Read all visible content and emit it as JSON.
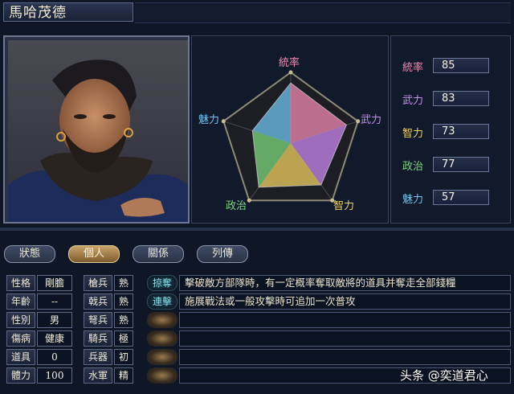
{
  "general": {
    "name": "馬哈茂德"
  },
  "radar": {
    "labels": {
      "top": "統率",
      "right": "武力",
      "bottom_right": "智力",
      "bottom_left": "政治",
      "left": "魅力"
    },
    "max": 100
  },
  "stats": [
    {
      "label": "統率",
      "value": "85",
      "num": 85,
      "color": "#f08ab0"
    },
    {
      "label": "武力",
      "value": "83",
      "num": 83,
      "color": "#c98af0"
    },
    {
      "label": "智力",
      "value": "73",
      "num": 73,
      "color": "#f0d060"
    },
    {
      "label": "政治",
      "value": "77",
      "num": 77,
      "color": "#7ed87e"
    },
    {
      "label": "魅力",
      "value": "57",
      "num": 57,
      "color": "#6fc4f0"
    }
  ],
  "tabs": [
    {
      "label": "狀態",
      "active": false
    },
    {
      "label": "個人",
      "active": true
    },
    {
      "label": "關係",
      "active": false
    },
    {
      "label": "列傳",
      "active": false
    }
  ],
  "attributes": [
    {
      "label": "性格",
      "value": "剛膽"
    },
    {
      "label": "年齡",
      "value": "--"
    },
    {
      "label": "性別",
      "value": "男"
    },
    {
      "label": "傷病",
      "value": "健康"
    },
    {
      "label": "道具",
      "value": "0"
    },
    {
      "label": "體力",
      "value": "100"
    }
  ],
  "aptitudes": [
    {
      "label": "槍兵",
      "grade": "熟"
    },
    {
      "label": "戟兵",
      "grade": "熟"
    },
    {
      "label": "弩兵",
      "grade": "熟"
    },
    {
      "label": "騎兵",
      "grade": "極"
    },
    {
      "label": "兵器",
      "grade": "初"
    },
    {
      "label": "水軍",
      "grade": "精"
    }
  ],
  "skills": [
    {
      "name": "掠奪",
      "desc": "擊破敵方部隊時，有一定概率奪取敵將的道具并奪走全部錢糧"
    },
    {
      "name": "連擊",
      "desc": "施展戰法或一般攻擊時可追加一次普攻"
    },
    {
      "name": "",
      "desc": ""
    },
    {
      "name": "",
      "desc": ""
    },
    {
      "name": "",
      "desc": ""
    },
    {
      "name": "",
      "desc": ""
    }
  ],
  "watermark": "头条 @奕道君心"
}
